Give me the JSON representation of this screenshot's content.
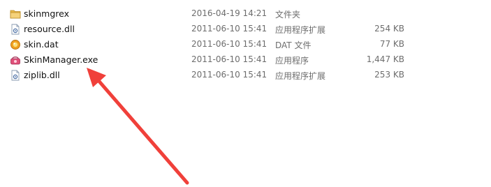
{
  "files": [
    {
      "name": "skinmgrex",
      "date": "2016-04-19 14:21",
      "type": "文件夹",
      "size": "",
      "icon": "folder-icon"
    },
    {
      "name": "resource.dll",
      "date": "2011-06-10 15:41",
      "type": "应用程序扩展",
      "size": "254 KB",
      "icon": "dll-file-icon"
    },
    {
      "name": "skin.dat",
      "date": "2011-06-10 15:41",
      "type": "DAT 文件",
      "size": "77 KB",
      "icon": "dat-file-icon"
    },
    {
      "name": "SkinManager.exe",
      "date": "2011-06-10 15:41",
      "type": "应用程序",
      "size": "1,447 KB",
      "icon": "exe-file-icon"
    },
    {
      "name": "ziplib.dll",
      "date": "2011-06-10 15:41",
      "type": "应用程序扩展",
      "size": "253 KB",
      "icon": "dll-file-icon"
    }
  ],
  "colors": {
    "annotation_arrow": "#f0403a",
    "folder": "#e8b84a"
  }
}
